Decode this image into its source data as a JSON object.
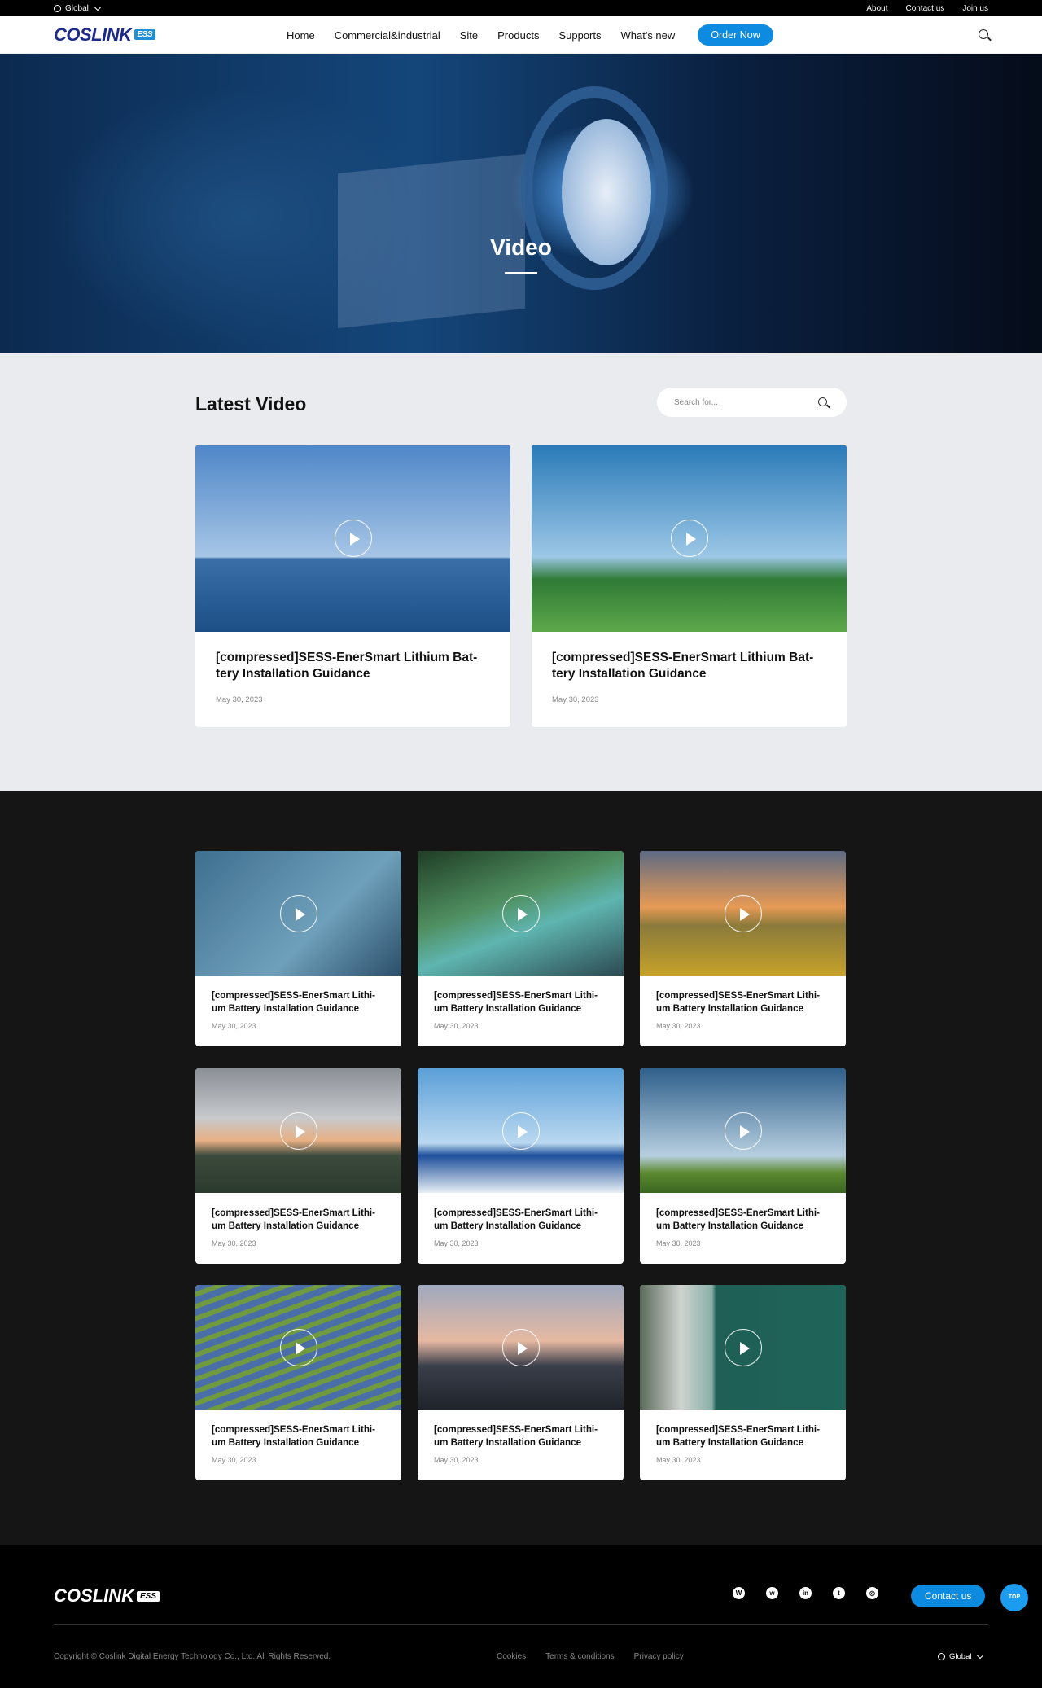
{
  "topbar": {
    "region": "Global",
    "links": [
      "About",
      "Contact us",
      "Join us"
    ]
  },
  "nav": {
    "logo": "COSLINK",
    "logo_tag": "ESS",
    "items": [
      "Home",
      "Commercial&industrial",
      "Site",
      "Products",
      "Supports",
      "What's new"
    ],
    "order": "Order Now"
  },
  "hero": {
    "title": "Video"
  },
  "latest": {
    "heading": "Latest Video",
    "search_placeholder": "Search for...",
    "cards": [
      {
        "title": "[compressed]SESS-EnerSmart Lithium Bat-tery Installation Guidance",
        "date": "May 30, 2023"
      },
      {
        "title": "[compressed]SESS-EnerSmart Lithium Bat-tery Installation Guidance",
        "date": "May 30, 2023"
      }
    ]
  },
  "grid": {
    "cards": [
      {
        "title": "[compressed]SESS-EnerSmart Lithi-um Battery Installation Guidance",
        "date": "May 30, 2023"
      },
      {
        "title": "[compressed]SESS-EnerSmart Lithi-um Battery Installation Guidance",
        "date": "May 30, 2023"
      },
      {
        "title": "[compressed]SESS-EnerSmart Lithi-um Battery Installation Guidance",
        "date": "May 30, 2023"
      },
      {
        "title": "[compressed]SESS-EnerSmart Lithi-um Battery Installation Guidance",
        "date": "May 30, 2023"
      },
      {
        "title": "[compressed]SESS-EnerSmart Lithi-um Battery Installation Guidance",
        "date": "May 30, 2023"
      },
      {
        "title": "[compressed]SESS-EnerSmart Lithi-um Battery Installation Guidance",
        "date": "May 30, 2023"
      },
      {
        "title": "[compressed]SESS-EnerSmart Lithi-um Battery Installation Guidance",
        "date": "May 30, 2023"
      },
      {
        "title": "[compressed]SESS-EnerSmart Lithi-um Battery Installation Guidance",
        "date": "May 30, 2023"
      },
      {
        "title": "[compressed]SESS-EnerSmart Lithi-um Battery Installation Guidance",
        "date": "May 30, 2023"
      }
    ]
  },
  "footer": {
    "logo": "COSLINK",
    "logo_tag": "ESS",
    "contact": "Contact us",
    "top": "TOP",
    "copyright": "Copyright © Coslink Digital Energy Technology Co., Ltd. All Rights Reserved.",
    "links": [
      "Cookies",
      "Terms & conditions",
      "Privacy policy"
    ],
    "region": "Global"
  },
  "colors": {
    "accent": "#0d8be0",
    "dark_bg": "#151515",
    "light_bg": "#e9ebee"
  },
  "icons": [
    "globe-icon",
    "search-icon",
    "play-icon",
    "whatsapp-icon",
    "wechat-icon",
    "linkedin-icon",
    "twitter-icon",
    "instagram-icon"
  ]
}
